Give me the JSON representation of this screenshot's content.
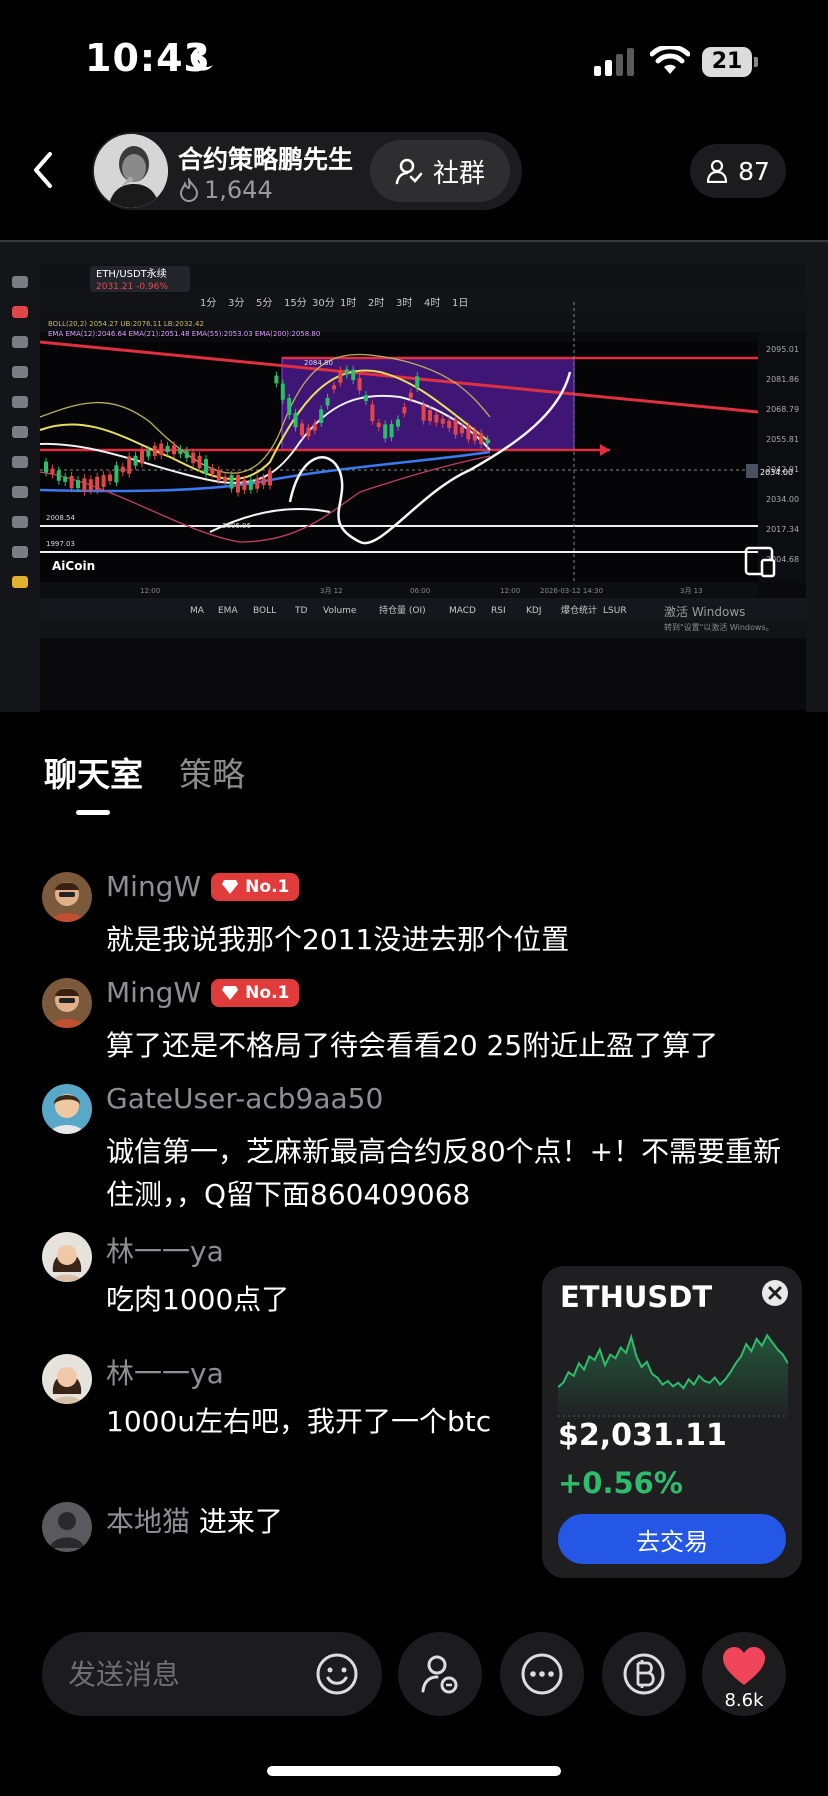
{
  "status": {
    "time": "10:43",
    "battery": "21"
  },
  "header": {
    "host_name": "合约策略鹏先生",
    "fans": "1,644",
    "community_label": "社群",
    "viewers": "87"
  },
  "stream": {
    "pair_tab": "ETH/USDT永续",
    "pair_price": "2031.21 -0.96%",
    "intervals": [
      "1分",
      "3分",
      "5分",
      "15分",
      "30分",
      "1时",
      "2时",
      "3时",
      "4时",
      "1日"
    ],
    "boll_line": "BOLL(20,2)  2054.27  UB:2076.11  LB:2032.42",
    "ema_line": "EMA  EMA(12):2046.64  EMA(21):2051.48  EMA(55):2053.03  EMA(200):2058.80",
    "price_levels": [
      "2095.01",
      "2081.86",
      "2068.79",
      "2055.81",
      "2042.91",
      "2034.00",
      "2017.34",
      "2004.68"
    ],
    "high_label": "2084.80",
    "low_label": "2006.06",
    "left_level": "2008.54",
    "bottom_level": "1997.03",
    "time_labels": [
      "12:00",
      "3月 12",
      "06:00",
      "12:00",
      "2026-03-12 14:30",
      "3月 13"
    ],
    "brand": "AiCoin",
    "indicator_tabs": [
      "MA",
      "EMA",
      "BOLL",
      "TD",
      "Volume",
      "持仓量 (OI)",
      "MACD",
      "RSI",
      "KDJ",
      "爆仓统计",
      "LSUR"
    ],
    "windows_notice": "激活 Windows",
    "windows_notice2": "转到\"设置\"以激活 Windows。"
  },
  "tabs": {
    "chat": "聊天室",
    "strategy": "策略"
  },
  "messages": [
    {
      "user": "MingW",
      "badge": "No.1",
      "text": "就是我说我那个2011没进去那个位置"
    },
    {
      "user": "MingW",
      "badge": "No.1",
      "text": "算了还是不格局了待会看看20 25附近止盈了算了"
    },
    {
      "user": "GateUser-acb9aa50",
      "text": "诚信第一，芝麻新最高合约反80个点！+！不需要重新住测，，Q留下面860409068"
    },
    {
      "user": "林一一ya",
      "text": "吃肉1000点了"
    },
    {
      "user": "林一一ya",
      "text": "1000u左右吧，我开了一个btc"
    }
  ],
  "join": {
    "user": "本地猫",
    "action": "进来了"
  },
  "price_card": {
    "symbol": "ETHUSDT",
    "price": "$2,031.11",
    "change": "+0.56%",
    "trade_label": "去交易",
    "spark": [
      0.35,
      0.4,
      0.52,
      0.48,
      0.62,
      0.55,
      0.7,
      0.66,
      0.78,
      0.6,
      0.72,
      0.68,
      0.8,
      0.74,
      0.92,
      0.7,
      0.58,
      0.64,
      0.5,
      0.46,
      0.38,
      0.42,
      0.36,
      0.4,
      0.34,
      0.44,
      0.38,
      0.48,
      0.42,
      0.4,
      0.46,
      0.38,
      0.44,
      0.52,
      0.62,
      0.7,
      0.84,
      0.76,
      0.9,
      0.82,
      0.94,
      0.86,
      0.78,
      0.72,
      0.62
    ],
    "colors": {
      "up": "#2ebd6c",
      "button": "#2457e6"
    }
  },
  "input": {
    "placeholder": "发送消息"
  },
  "likes": "8.6k"
}
